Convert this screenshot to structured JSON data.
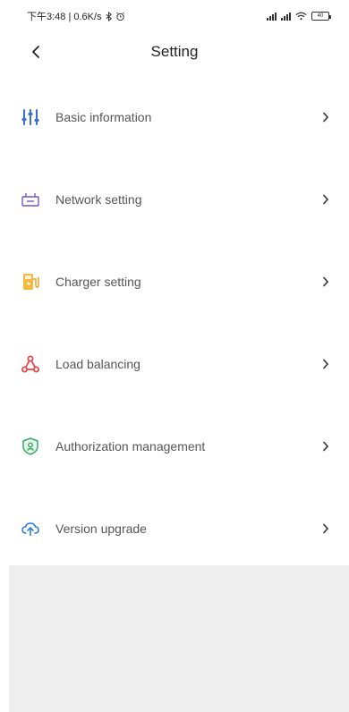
{
  "status_bar": {
    "left_text": "下午3:48 | 0.6K/s",
    "battery_text": "40"
  },
  "header": {
    "title": "Setting"
  },
  "menu": [
    {
      "label": "Basic information",
      "icon": "sliders-icon",
      "color": "#3b6fd4"
    },
    {
      "label": "Network setting",
      "icon": "router-icon",
      "color": "#6b5cc7"
    },
    {
      "label": "Charger setting",
      "icon": "charger-icon",
      "color": "#f0a020"
    },
    {
      "label": "Load balancing",
      "icon": "triangle-nodes-icon",
      "color": "#e04848"
    },
    {
      "label": "Authorization management",
      "icon": "shield-user-icon",
      "color": "#3aaa66"
    },
    {
      "label": "Version upgrade",
      "icon": "cloud-upload-icon",
      "color": "#2f7fd8"
    }
  ]
}
